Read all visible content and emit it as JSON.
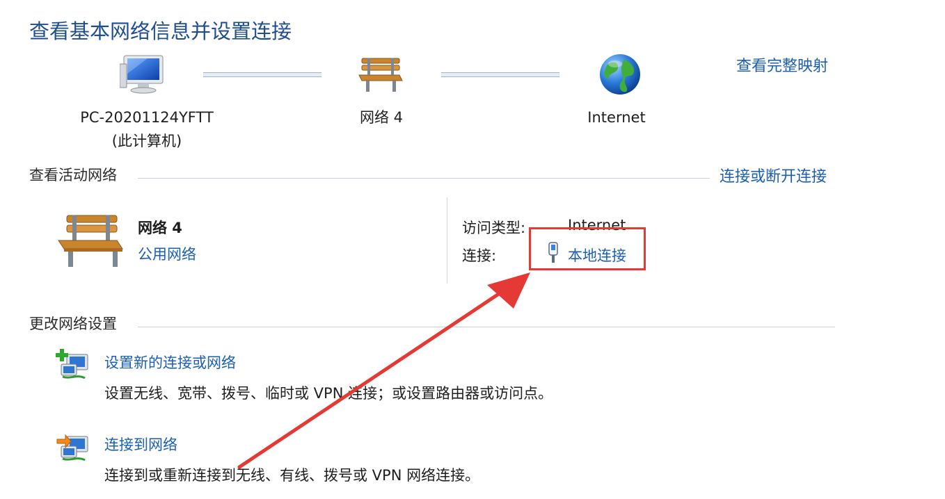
{
  "header": {
    "title": "查看基本网络信息并设置连接",
    "view_full_map": "查看完整映射"
  },
  "network_map": {
    "computer": {
      "name": "PC-20201124YFTT",
      "sub": "(此计算机)",
      "icon": "computer-icon"
    },
    "network": {
      "name": "网络  4",
      "icon": "bench-icon"
    },
    "internet": {
      "name": "Internet",
      "icon": "globe-icon"
    }
  },
  "active_networks": {
    "heading": "查看活动网络",
    "connect_disconnect": "连接或断开连接",
    "network_name": "网络  4",
    "network_type": "公用网络",
    "access_type_label": "访问类型:",
    "access_type_value": "Internet",
    "connection_label": "连接:",
    "connection_value": "本地连接",
    "connection_icon": "ethernet-plug-icon"
  },
  "change_settings": {
    "heading": "更改网络设置",
    "tasks": [
      {
        "title": "设置新的连接或网络",
        "desc": "设置无线、宽带、拨号、临时或 VPN 连接；或设置路由器或访问点。",
        "icon": "new-connection-icon"
      },
      {
        "title": "连接到网络",
        "desc": "连接到或重新连接到无线、有线、拨号或 VPN 网络连接。",
        "icon": "connect-network-icon"
      }
    ]
  },
  "annotation": {
    "highlight_color": "#e53935",
    "link_color": "#1a5fb4",
    "title_color": "#1f4e8f"
  }
}
